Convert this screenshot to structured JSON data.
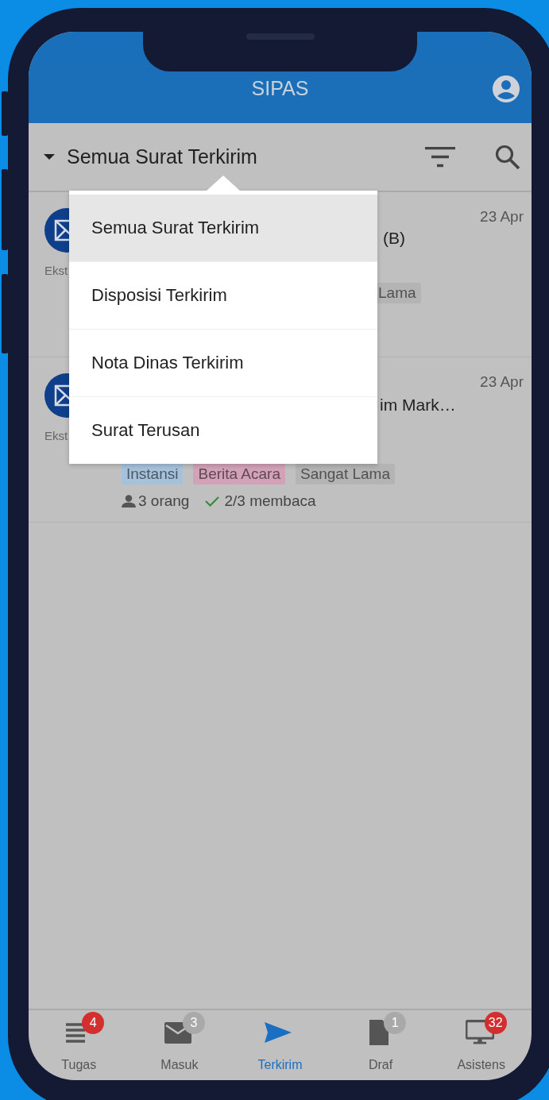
{
  "app_bar": {
    "title": "SIPAS"
  },
  "toolbar": {
    "filter_label": "Semua Surat Terkirim"
  },
  "letters": [
    {
      "sender_type": "Ekst",
      "date": "23 Apr",
      "title": "(B)",
      "tags": [
        {
          "label": "Lama",
          "color": "#b4b4b4"
        }
      ]
    },
    {
      "sender_type": "Ekst",
      "date": "23 Apr",
      "title": "im Mark…",
      "tags": [
        {
          "label": "Instansi",
          "color": "#a6c2db"
        },
        {
          "label": "Berita Acara",
          "color": "#d3a2b9"
        },
        {
          "label": "Sangat Lama",
          "color": "#b4b4b4"
        }
      ],
      "recipients": "3 orang",
      "read_status": "2/3 membaca"
    }
  ],
  "menu": [
    {
      "label": "Semua Surat Terkirim",
      "selected": true
    },
    {
      "label": "Disposisi Terkirim",
      "selected": false
    },
    {
      "label": "Nota Dinas Terkirim",
      "selected": false
    },
    {
      "label": "Surat Terusan",
      "selected": false
    }
  ],
  "bottom_nav": [
    {
      "label": "Tugas",
      "kind": "list",
      "selected": false,
      "badge": {
        "count": "4",
        "color": "#d32f2f"
      }
    },
    {
      "label": "Masuk",
      "kind": "mail",
      "selected": false,
      "badge": {
        "count": "3",
        "color": "#a9a9a9"
      }
    },
    {
      "label": "Terkirim",
      "kind": "send",
      "selected": true
    },
    {
      "label": "Draf",
      "kind": "doc",
      "selected": false,
      "badge": {
        "count": "1",
        "color": "#a9a9a9"
      }
    },
    {
      "label": "Asistens",
      "kind": "monitor",
      "selected": false,
      "badge": {
        "count": "32",
        "color": "#d32f2f"
      }
    }
  ]
}
